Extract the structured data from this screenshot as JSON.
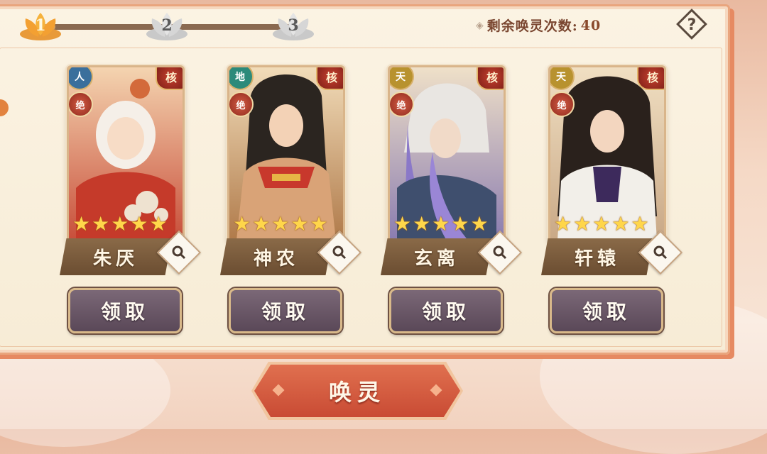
{
  "progress": {
    "stages": [
      "1",
      "2",
      "3"
    ],
    "current_stage": 1,
    "fill_fraction": 0.05
  },
  "remaining": {
    "label": "剩余唤灵次数:",
    "count": "40"
  },
  "help_icon": "question-icon",
  "cards": [
    {
      "name": "朱厌",
      "faction": "人",
      "faction_color": "#3a6f9c",
      "core": "核",
      "tag": "绝",
      "stars": 5,
      "claim": "领取"
    },
    {
      "name": "神农",
      "faction": "地",
      "faction_color": "#2b8a7a",
      "core": "核",
      "tag": "绝",
      "stars": 5,
      "claim": "领取"
    },
    {
      "name": "玄离",
      "faction": "天",
      "faction_color": "#b8922e",
      "core": "核",
      "tag": "绝",
      "stars": 5,
      "claim": "领取"
    },
    {
      "name": "轩辕",
      "faction": "天",
      "faction_color": "#b8922e",
      "core": "核",
      "tag": "绝",
      "stars": 5,
      "claim": "领取"
    }
  ],
  "summon_button": "唤灵",
  "colors": {
    "accent": "#c94b34",
    "panel": "#fbf3e3",
    "nameplate": "#6b4d31"
  }
}
